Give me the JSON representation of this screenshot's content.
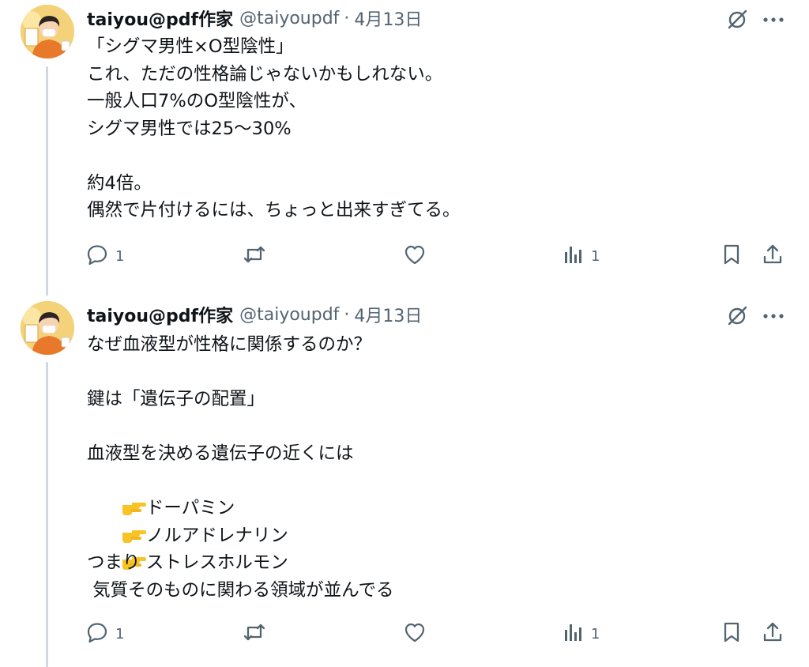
{
  "tweets": [
    {
      "author": {
        "display_name": "taiyou@pdf作家",
        "handle": "@taiyoupdf",
        "separator": "·",
        "date": "4月13日"
      },
      "lines": [
        "「シグマ男性×O型陰性」",
        "これ、ただの性格論じゃないかもしれない。",
        "一般人口7%のO型陰性が、",
        "シグマ男性では25〜30%",
        "",
        "約4倍。",
        "偶然で片付けるには、ちょっと出来すぎてる。"
      ],
      "actions": {
        "reply_count": "1",
        "repost_count": "",
        "like_count": "",
        "views_count": "1"
      }
    },
    {
      "author": {
        "display_name": "taiyou@pdf作家",
        "handle": "@taiyoupdf",
        "separator": "·",
        "date": "4月13日"
      },
      "lines": [
        "なぜ血液型が性格に関係するのか？",
        "",
        "鍵は「遺伝子の配置」",
        "",
        "血液型を決める遺伝子の近くには",
        "ドーパミン",
        "ノルアドレナリン",
        "ストレスホルモン",
        "つまり",
        " 気質そのものに関わる領域が並んでる"
      ],
      "bullet_lines": [
        5,
        6,
        7
      ],
      "bullet_icon": "pointing-finger-icon",
      "actions": {
        "reply_count": "1",
        "repost_count": "",
        "like_count": "",
        "views_count": "1"
      }
    }
  ],
  "icons": {
    "grok": "grok-icon",
    "more": "more-options-icon",
    "reply": "reply-icon",
    "repost": "repost-icon",
    "like": "like-icon",
    "views": "views-icon",
    "bookmark": "bookmark-icon",
    "share": "share-icon"
  },
  "colors": {
    "text": "#0f1419",
    "muted": "#536471",
    "thread_line": "#cfd9de",
    "emoji": "#f7c325"
  }
}
